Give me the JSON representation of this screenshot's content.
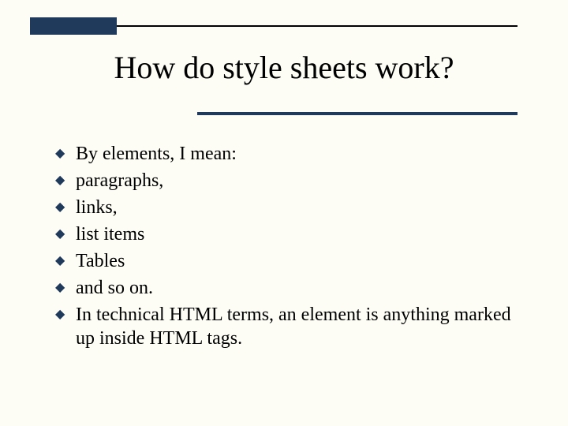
{
  "title": "How do style sheets work?",
  "bullets": [
    "By elements, I mean:",
    " paragraphs,",
    "links,",
    "list items",
    "Tables",
    "and so on.",
    "In technical HTML terms, an element is anything marked up inside HTML tags."
  ]
}
